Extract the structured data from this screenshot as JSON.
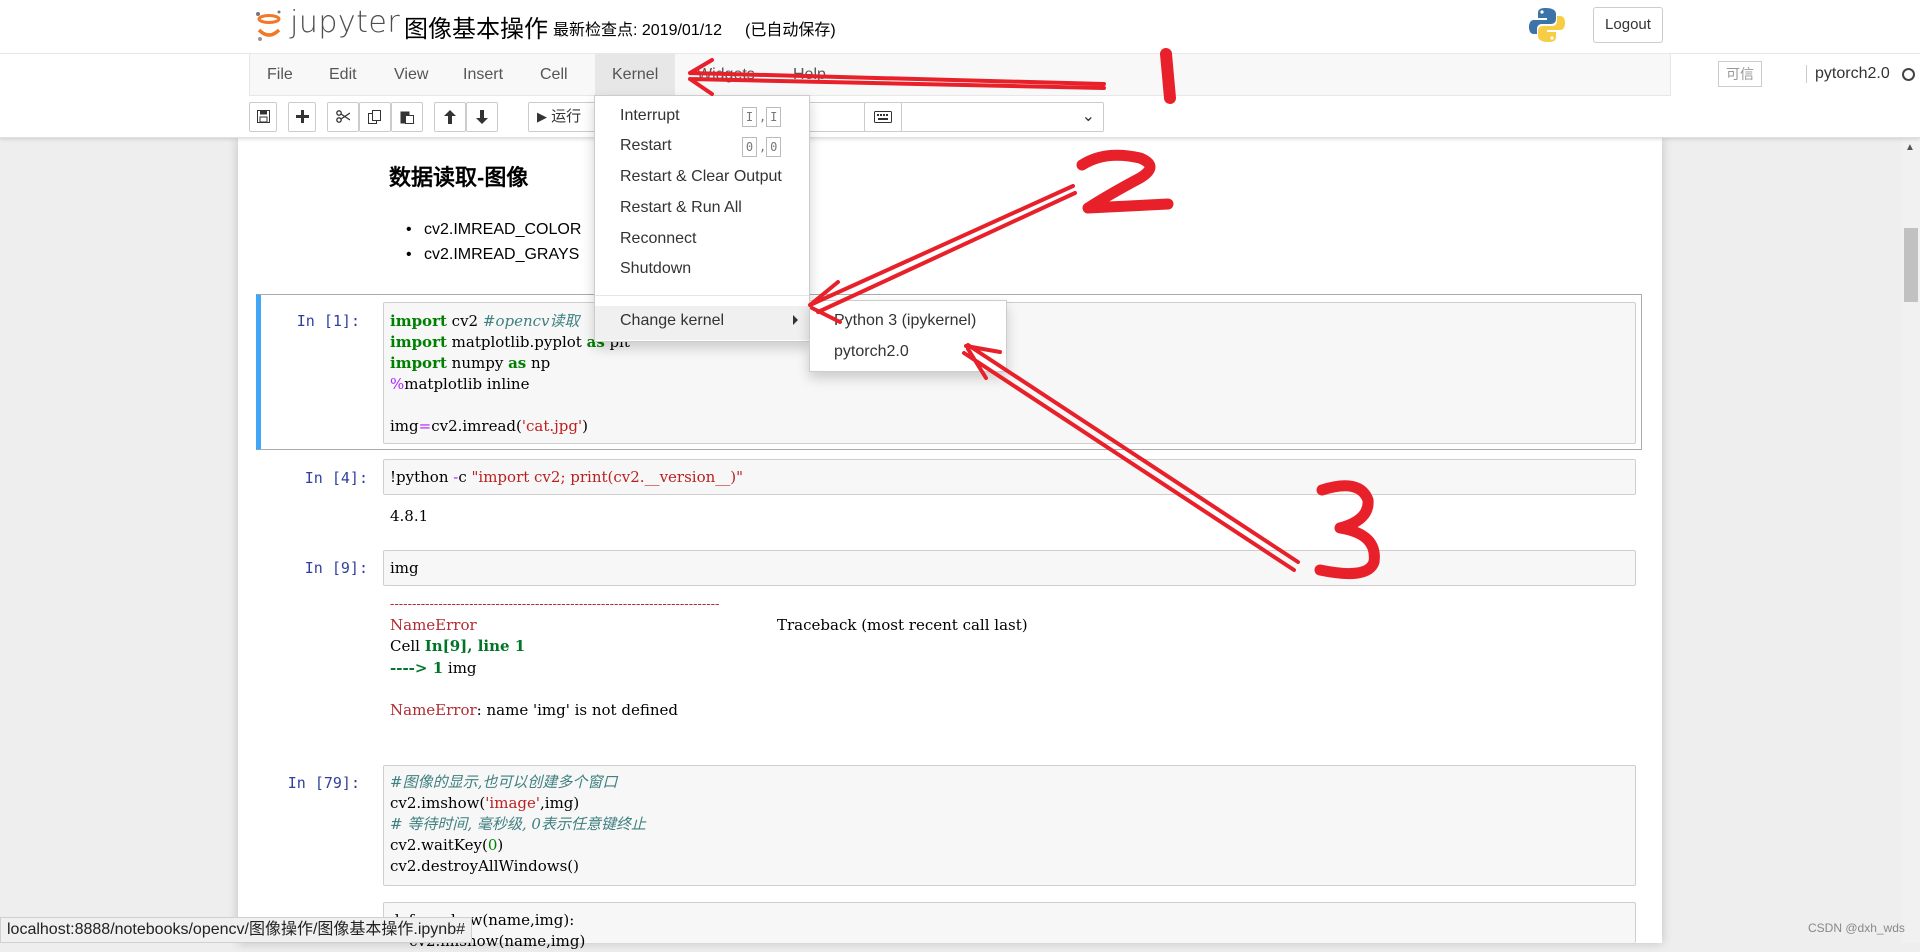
{
  "header": {
    "logo_text": "jupyter",
    "notebook_name": "图像基本操作",
    "checkpoint": "最新检查点: 2019/01/12",
    "autosave": "(已自动保存)",
    "logout": "Logout"
  },
  "menubar": {
    "items": [
      "File",
      "Edit",
      "View",
      "Insert",
      "Cell",
      "Kernel",
      "Widgets",
      "Help"
    ],
    "trusted": "可信",
    "kernel_name": "pytorch2.0"
  },
  "toolbar": {
    "run_label": "运行",
    "icons": [
      "save-icon",
      "plus-icon",
      "cut-icon",
      "copy-icon",
      "paste-icon",
      "arrow-up-icon",
      "arrow-down-icon",
      "play-icon",
      "keyboard-icon"
    ]
  },
  "kernel_menu": {
    "items": [
      "Interrupt",
      "Restart",
      "Restart & Clear Output",
      "Restart & Run All",
      "Reconnect",
      "Shutdown",
      "Change kernel"
    ],
    "interrupt_shortcut": [
      "I",
      "I"
    ],
    "restart_shortcut": [
      "0",
      "0"
    ]
  },
  "change_kernel_submenu": {
    "items": [
      "Python 3 (ipykernel)",
      "pytorch2.0"
    ]
  },
  "markdown": {
    "heading": "数据读取-图像",
    "bullets": [
      "cv2.IMREAD_COLOR",
      "cv2.IMREAD_GRAYS"
    ]
  },
  "cells": {
    "c1": {
      "prompt": "In  [1]:",
      "kw_import": "import",
      "l1_rest": " cv2 ",
      "l1_comment": "#opencv读取",
      "l2_rest": " matplotlib.pyplot ",
      "kw_as": "as",
      "l2_tail": " plt",
      "l3_rest": " numpy ",
      "l3_tail": " np",
      "l4_pct": "%",
      "l4_rest": "matplotlib inline",
      "l6_a": "img",
      "l6_eq": "=",
      "l6_b": "cv2.imread(",
      "l6_str": "'cat.jpg'",
      "l6_c": ")"
    },
    "c4": {
      "prompt": "In  [4]:",
      "code_a": "!python ",
      "code_op": "-",
      "code_b": "c ",
      "code_str": "\"import cv2; print(cv2.__version__)\"",
      "output": "4.8.1"
    },
    "c9": {
      "prompt": "In  [9]:",
      "code": "img",
      "dashes": "---------------------------------------------------------------------------",
      "err_name": "NameError",
      "traceback": "Traceback (most recent call last)",
      "cell_prefix": "Cell ",
      "cell_ref": "In[9], line 1",
      "arrow": "----> ",
      "arrow_line": "1",
      "arrow_code": " img",
      "err_msg": ": name 'img' is not defined"
    },
    "c79": {
      "prompt": "In  [79]:",
      "l1": "#图像的显示,也可以创建多个窗口",
      "l2_a": "cv2.imshow(",
      "l2_str": "'image'",
      "l2_b": ",img)",
      "l3": "# 等待时间, 毫秒级, 0表示任意键终止",
      "l4_a": "cv2.waitKey(",
      "l4_num": "0",
      "l4_b": ")",
      "l5": "cv2.destroyAllWindows()"
    },
    "c_last": {
      "l1_visible": "def cv_show(name,img):",
      "l2_visible": "    cv2.imshow(name,img)"
    }
  },
  "status_bar": "localhost:8888/notebooks/opencv/图像操作/图像基本操作.ipynb#",
  "watermark": "CSDN @dxh_wds",
  "colors": {
    "selected_cell_border": "#42a5f5",
    "annotation": "#e8202a",
    "prompt": "#303f9f",
    "keyword": "#008000",
    "error": "#b22b31"
  }
}
